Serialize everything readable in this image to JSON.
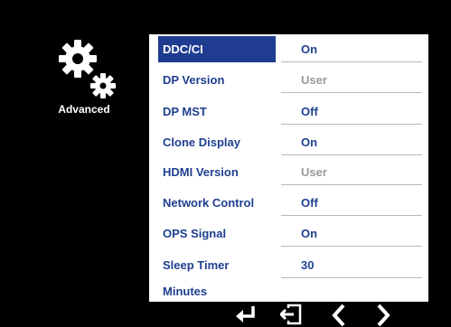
{
  "sidebar": {
    "icon": "gears-icon",
    "label": "Advanced"
  },
  "menu": {
    "items": [
      {
        "label": "DDC/CI",
        "value": "On",
        "selected": true,
        "enabled": true
      },
      {
        "label": "DP Version",
        "value": "User",
        "selected": false,
        "enabled": false
      },
      {
        "label": "DP MST",
        "value": "Off",
        "selected": false,
        "enabled": true
      },
      {
        "label": "Clone Display",
        "value": "On",
        "selected": false,
        "enabled": true
      },
      {
        "label": "HDMI Version",
        "value": "User",
        "selected": false,
        "enabled": false
      },
      {
        "label": "Network Control",
        "value": "Off",
        "selected": false,
        "enabled": true
      },
      {
        "label": "OPS Signal",
        "value": "On",
        "selected": false,
        "enabled": true
      },
      {
        "label": "Sleep Timer Minutes",
        "value": "30",
        "selected": false,
        "enabled": true
      }
    ]
  },
  "nav": {
    "buttons": [
      "enter-icon",
      "exit-icon",
      "left-arrow-icon",
      "right-arrow-icon"
    ]
  },
  "colors": {
    "accent": "#1f3c91",
    "text": "#1f3f8f",
    "disabled": "#9a9a9a"
  }
}
